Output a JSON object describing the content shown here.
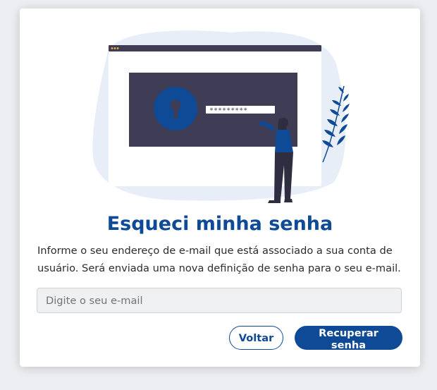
{
  "dialog": {
    "title": "Esqueci minha senha",
    "description": "Informe o seu endereço de e-mail que está associado a sua conta de usuário. Será enviada uma nova definição de senha para o seu e-mail.",
    "email": {
      "placeholder": "Digite o seu e-mail",
      "value": ""
    },
    "buttons": {
      "back_label": "Voltar",
      "recover_label": "Recuperar senha"
    }
  },
  "illustration": {
    "password_mask": "*********",
    "icons": [
      "lock-keyhole-icon",
      "plant-leaf-icon"
    ]
  },
  "colors": {
    "primary": "#0f4a97",
    "background": "#eceef1",
    "card": "#ffffff",
    "illustration_blob": "#e8eef7",
    "screen_dark": "#3f3d56"
  }
}
